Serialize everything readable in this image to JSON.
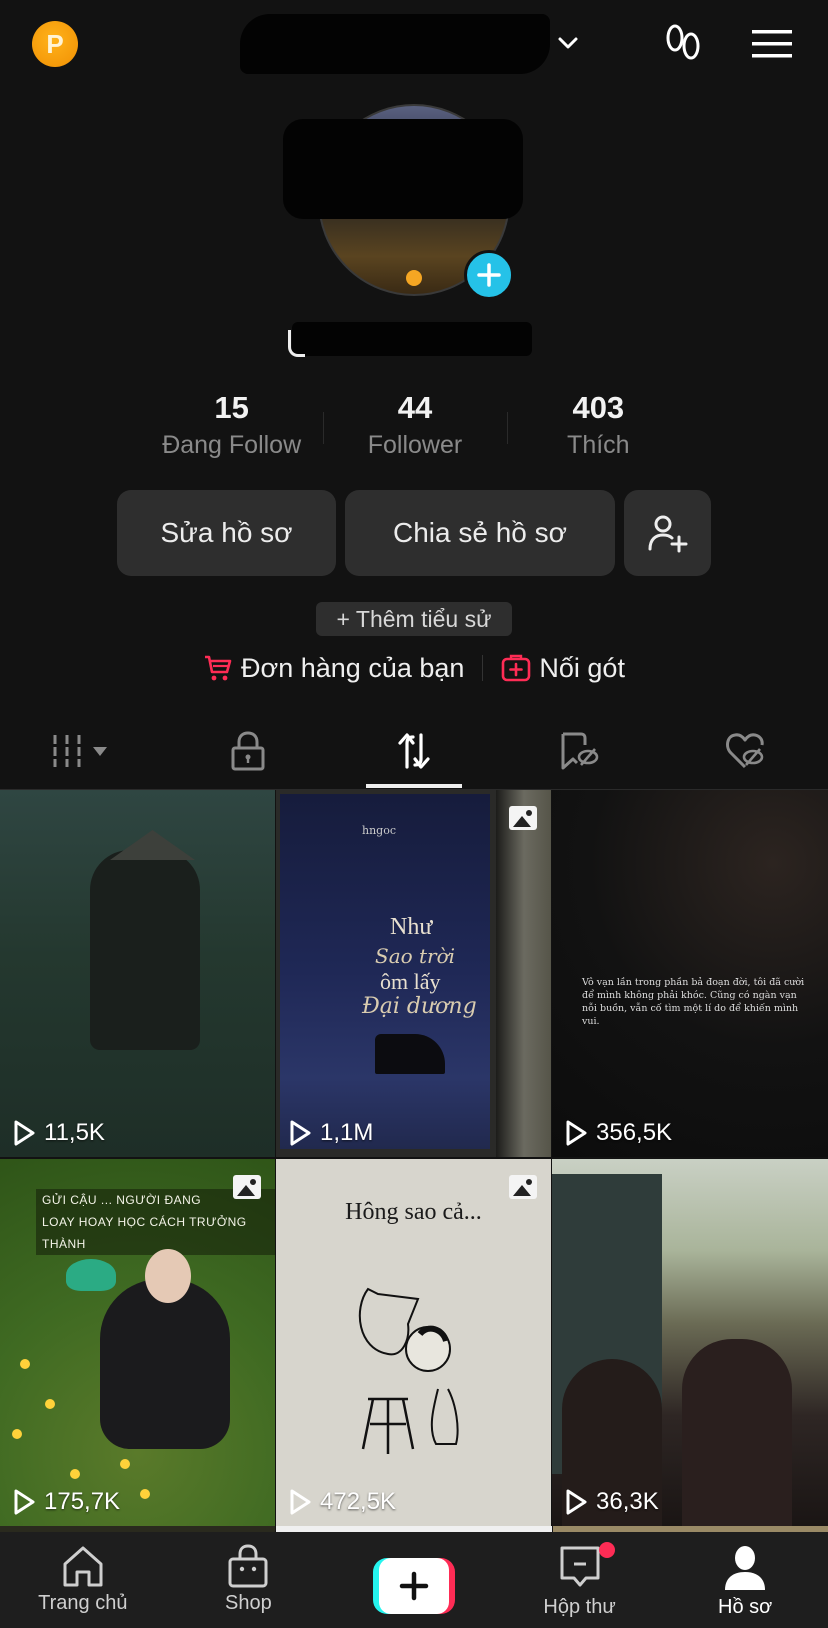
{
  "header": {
    "coin_letter": "P",
    "account_switcher": "account-switcher",
    "icons": [
      "coin-icon",
      "chevron-down-icon",
      "footprint-icon",
      "menu-icon"
    ]
  },
  "profile": {
    "stats": [
      {
        "value": "15",
        "label": "Đang Follow"
      },
      {
        "value": "44",
        "label": "Follower"
      },
      {
        "value": "403",
        "label": "Thích"
      }
    ],
    "buttons": {
      "edit": "Sửa hồ sơ",
      "share": "Chia sẻ hồ sơ"
    },
    "add_bio": "+ Thêm tiểu sử",
    "links": [
      {
        "label": "Đơn hàng của bạn",
        "icon": "cart-icon",
        "color": "#fe2c55"
      },
      {
        "label": "Nối gót",
        "icon": "add-box-icon",
        "color": "#fe2c55"
      }
    ]
  },
  "tabs": [
    {
      "name": "videos",
      "icon": "grid-icon",
      "active": false
    },
    {
      "name": "private",
      "icon": "lock-icon",
      "active": false
    },
    {
      "name": "reposts",
      "icon": "repost-icon",
      "active": true
    },
    {
      "name": "favorites",
      "icon": "bookmark-hidden-icon",
      "active": false
    },
    {
      "name": "liked",
      "icon": "heart-hidden-icon",
      "active": false
    }
  ],
  "videos": [
    {
      "views": "11,5K",
      "photo": false
    },
    {
      "views": "1,1M",
      "photo": true,
      "poster": {
        "author": "hngoc",
        "line1": "Như",
        "line2": "Sao trời",
        "line3": "ôm lấy",
        "line4": "Đại dương"
      }
    },
    {
      "views": "356,5K",
      "photo": false,
      "text": "Vô vạn lần trong phần bả đoạn đời, tôi đã cười để mình không phải khóc. Cũng có ngàn vạn nỗi buồn, vẫn cố tìm một lí do để khiến mình vui."
    },
    {
      "views": "175,7K",
      "photo": true,
      "caption1": "GỬI CẬU ... NGƯỜI ĐANG",
      "caption2": "LOAY HOAY HỌC CÁCH TRƯỞNG THÀNH"
    },
    {
      "views": "472,5K",
      "photo": true,
      "title": "Hông sao cả..."
    },
    {
      "views": "36,3K",
      "photo": false
    }
  ],
  "bottom_nav": [
    {
      "label": "Trang chủ",
      "icon": "home-icon"
    },
    {
      "label": "Shop",
      "icon": "shop-bag-icon"
    },
    {
      "label": "",
      "icon": "create-plus-icon"
    },
    {
      "label": "Hộp thư",
      "icon": "inbox-icon",
      "badge": true
    },
    {
      "label": "Hồ sơ",
      "icon": "profile-icon",
      "active": true
    }
  ],
  "colors": {
    "background": "#121212",
    "accent_red": "#fe2c55",
    "accent_cyan": "#25f4ee",
    "avatar_add": "#25c2e8",
    "coin": "#f59a0a"
  }
}
